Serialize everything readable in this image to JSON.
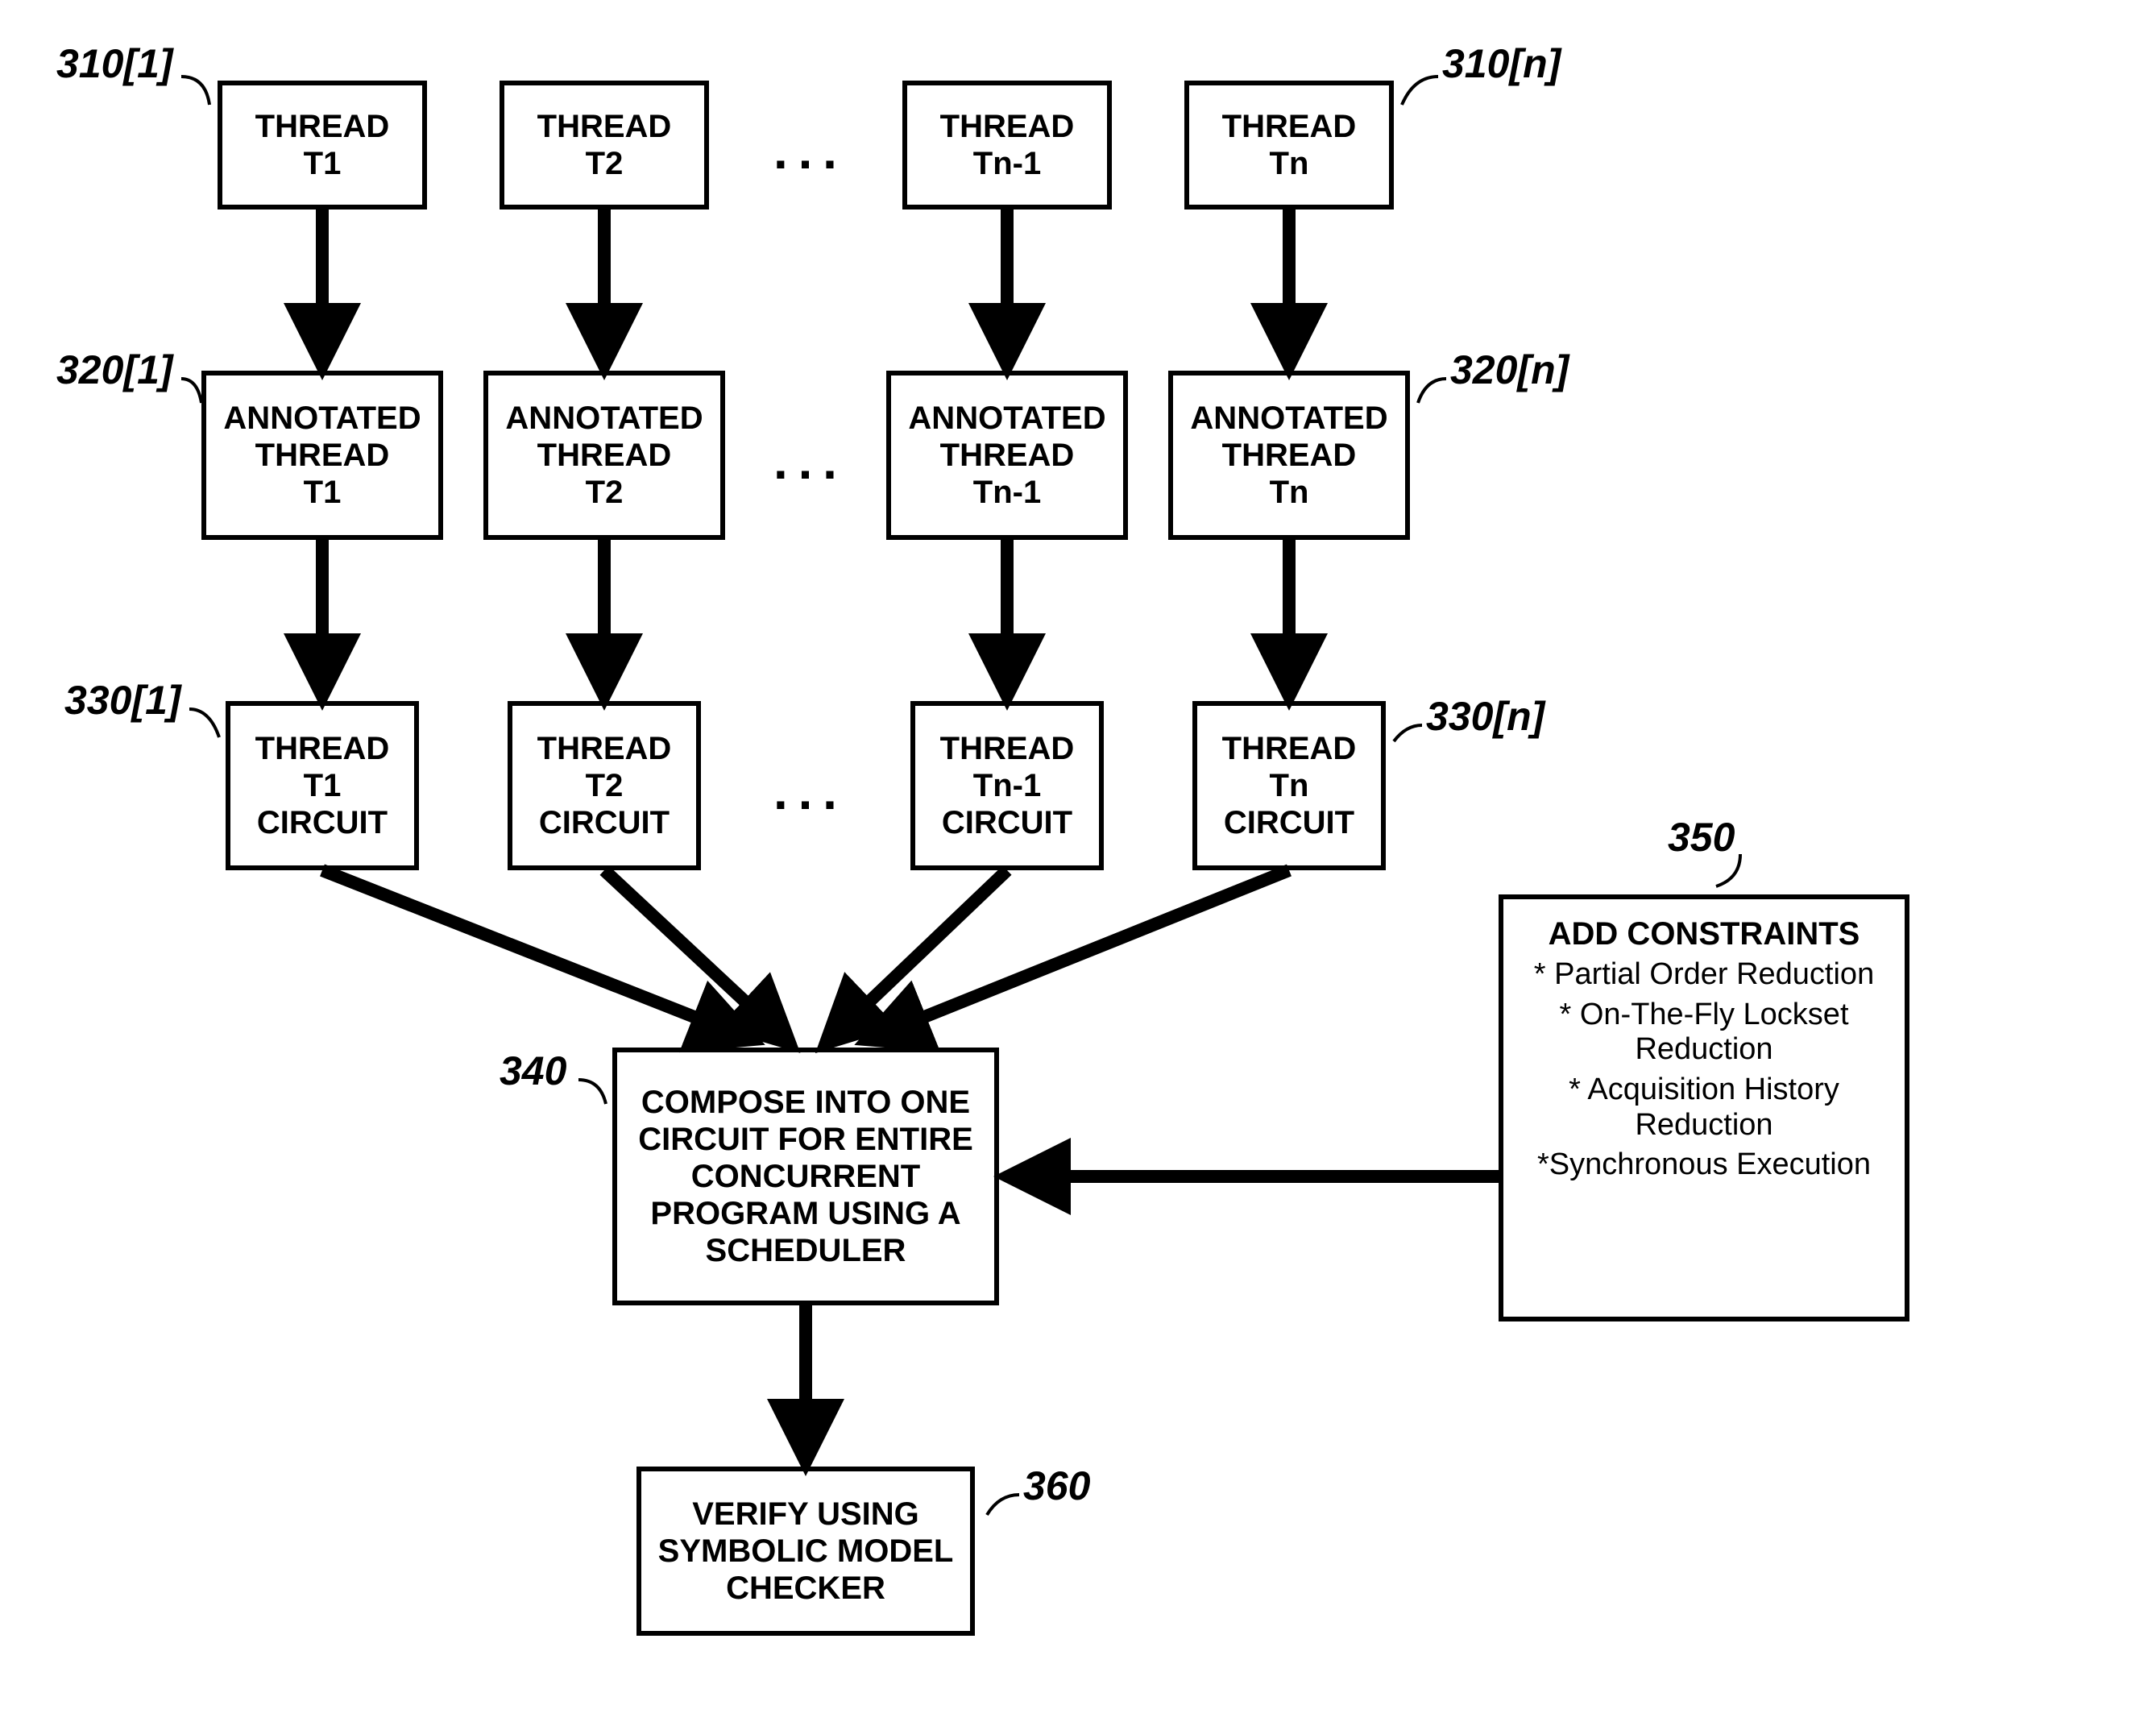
{
  "labels": {
    "l310_1": "310[1]",
    "l310_n": "310[n]",
    "l320_1": "320[1]",
    "l320_n": "320[n]",
    "l330_1": "330[1]",
    "l330_n": "330[n]",
    "l340": "340",
    "l350": "350",
    "l360": "360"
  },
  "threads": {
    "t1": "THREAD\nT1",
    "t2": "THREAD\nT2",
    "tnm1": "THREAD\nTn-1",
    "tn": "THREAD\nTn"
  },
  "annotated": {
    "t1": "ANNOTATED\nTHREAD\nT1",
    "t2": "ANNOTATED\nTHREAD\nT2",
    "tnm1": "ANNOTATED\nTHREAD\nTn-1",
    "tn": "ANNOTATED\nTHREAD\nTn"
  },
  "circuits": {
    "t1": "THREAD\nT1\nCIRCUIT",
    "t2": "THREAD\nT2\nCIRCUIT",
    "tnm1": "THREAD\nTn-1\nCIRCUIT",
    "tn": "THREAD\nTn\nCIRCUIT"
  },
  "compose": "COMPOSE INTO ONE\nCIRCUIT FOR ENTIRE\nCONCURRENT\nPROGRAM USING A\nSCHEDULER",
  "constraints_title": "ADD CONSTRAINTS",
  "constraints_items": [
    "* Partial Order Reduction",
    "* On-The-Fly Lockset Reduction",
    "* Acquisition History Reduction",
    "*Synchronous Execution"
  ],
  "verify": "VERIFY USING\nSYMBOLIC MODEL\nCHECKER",
  "ellipsis": "..."
}
